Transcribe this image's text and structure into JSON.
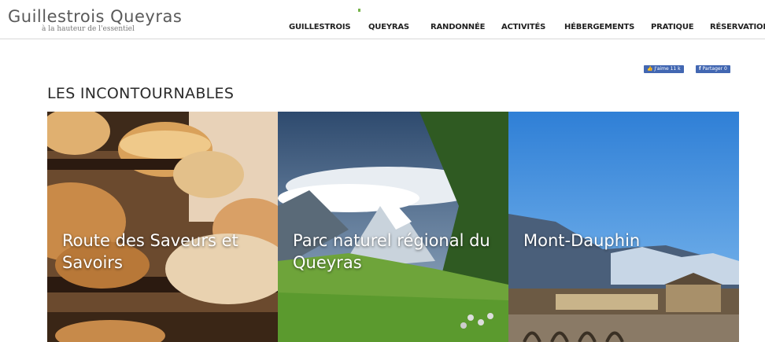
{
  "header": {
    "logo_title": "Guillestrois Queyras",
    "logo_tagline": "à la hauteur de l'essentiel"
  },
  "nav": {
    "items": [
      {
        "label": "GUILLESTROIS",
        "active": true
      },
      {
        "label": "QUEYRAS",
        "active": false
      },
      {
        "label": "RANDONNÉE",
        "active": false
      },
      {
        "label": "ACTIVITÉS",
        "active": false
      },
      {
        "label": "HÉBERGEMENTS",
        "active": false
      },
      {
        "label": "PRATIQUE",
        "active": false
      },
      {
        "label": "RÉSERVATION",
        "active": false
      }
    ]
  },
  "social": {
    "like_label": "J'aime 11 k",
    "share_label": "Partager 0"
  },
  "section": {
    "title": "LES INCONTOURNABLES"
  },
  "tiles": [
    {
      "label": "Route des Saveurs et Savoirs",
      "image": "cheese-wheels-on-shelves"
    },
    {
      "label": "Parc naturel régional du Queyras",
      "image": "mountain-meadow-with-sheep"
    },
    {
      "label": "Mont-Dauphin",
      "image": "fortified-village-and-mountains"
    }
  ],
  "colors": {
    "accent": "#77b44c",
    "facebook": "#4267b2",
    "text": "#222222"
  }
}
